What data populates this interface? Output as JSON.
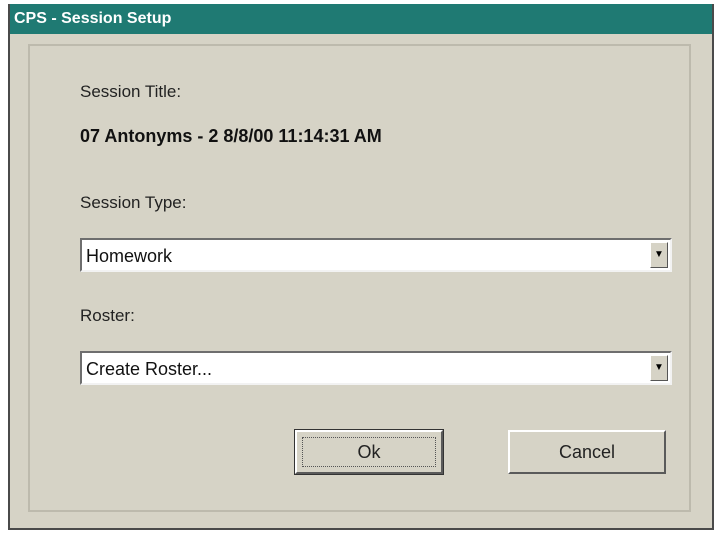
{
  "window": {
    "title": "CPS - Session Setup"
  },
  "form": {
    "session_title_label": "Session Title:",
    "session_title_value": "07 Antonyms - 2 8/8/00 11:14:31 AM",
    "session_type_label": "Session Type:",
    "session_type_value": "Homework",
    "roster_label": "Roster:",
    "roster_value": "Create Roster..."
  },
  "buttons": {
    "ok_label": "Ok",
    "cancel_label": "Cancel"
  },
  "icons": {
    "dropdown": "chevron-down-icon"
  },
  "colors": {
    "titlebar": "#1f7a73",
    "dialog_bg": "#d6d3c6"
  }
}
